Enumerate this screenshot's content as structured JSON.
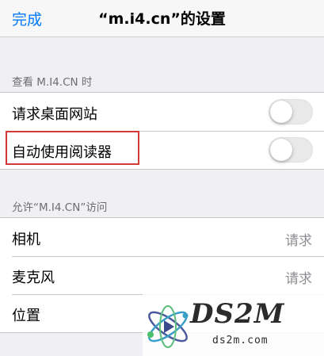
{
  "navbar": {
    "done_label": "完成",
    "title": "“m.i4.cn”的设置"
  },
  "section1": {
    "header": "查看 M.I4.CN 时",
    "rows": [
      {
        "label": "请求桌面网站",
        "toggle_on": false
      },
      {
        "label": "自动使用阅读器",
        "toggle_on": false
      }
    ]
  },
  "section2": {
    "header": "允许“M.I4.CN”访问",
    "rows": [
      {
        "label": "相机",
        "value": "请求"
      },
      {
        "label": "麦克风",
        "value": "请求"
      },
      {
        "label": "位置",
        "value": ""
      }
    ]
  },
  "watermark": {
    "logo_text": "DS2M",
    "subtext": "ds2m.com"
  },
  "colors": {
    "accent": "#007aff",
    "highlight": "#d23a3a",
    "background": "#efeff4"
  }
}
